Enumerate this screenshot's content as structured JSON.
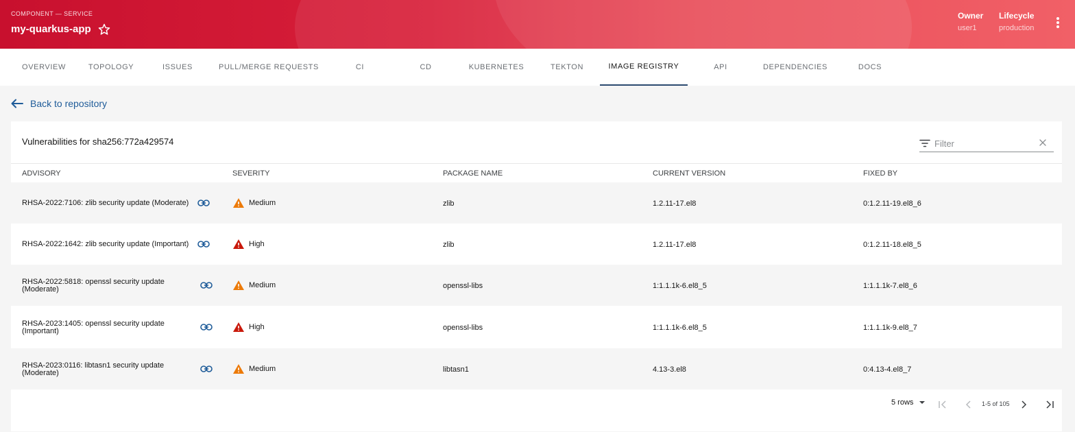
{
  "header": {
    "kind": "COMPONENT — SERVICE",
    "title": "my-quarkus-app",
    "owner_label": "Owner",
    "owner_value": "user1",
    "lifecycle_label": "Lifecycle",
    "lifecycle_value": "production"
  },
  "tabs": [
    {
      "label": "OVERVIEW"
    },
    {
      "label": "TOPOLOGY"
    },
    {
      "label": "ISSUES"
    },
    {
      "label": "PULL/MERGE REQUESTS"
    },
    {
      "label": "CI"
    },
    {
      "label": "CD"
    },
    {
      "label": "KUBERNETES"
    },
    {
      "label": "TEKTON"
    },
    {
      "label": "IMAGE REGISTRY",
      "active": true
    },
    {
      "label": "API"
    },
    {
      "label": "DEPENDENCIES"
    },
    {
      "label": "DOCS"
    }
  ],
  "back_link": "Back to repository",
  "table": {
    "title": "Vulnerabilities for sha256:772a429574",
    "filter_placeholder": "Filter",
    "columns": [
      "ADVISORY",
      "SEVERITY",
      "PACKAGE NAME",
      "CURRENT VERSION",
      "FIXED BY"
    ],
    "rows": [
      {
        "advisory": "RHSA-2022:7106: zlib security update (Moderate)",
        "severity": "Medium",
        "package": "zlib",
        "current": "1.2.11-17.el8",
        "fixed": "0:1.2.11-19.el8_6"
      },
      {
        "advisory": "RHSA-2022:1642: zlib security update (Important)",
        "severity": "High",
        "package": "zlib",
        "current": "1.2.11-17.el8",
        "fixed": "0:1.2.11-18.el8_5"
      },
      {
        "advisory": "RHSA-2022:5818: openssl security update (Moderate)",
        "severity": "Medium",
        "package": "openssl-libs",
        "current": "1:1.1.1k-6.el8_5",
        "fixed": "1:1.1.1k-7.el8_6"
      },
      {
        "advisory": "RHSA-2023:1405: openssl security update (Important)",
        "severity": "High",
        "package": "openssl-libs",
        "current": "1:1.1.1k-6.el8_5",
        "fixed": "1:1.1.1k-9.el8_7"
      },
      {
        "advisory": "RHSA-2023:0116: libtasn1 security update (Moderate)",
        "severity": "Medium",
        "package": "libtasn1",
        "current": "4.13-3.el8",
        "fixed": "0:4.13-4.el8_7"
      }
    ]
  },
  "pagination": {
    "rows_label": "5 rows",
    "range_label": "1-5 of 105"
  },
  "colors": {
    "medium": "#ec7a08",
    "high": "#c9190b",
    "link": "#1f5c99"
  }
}
